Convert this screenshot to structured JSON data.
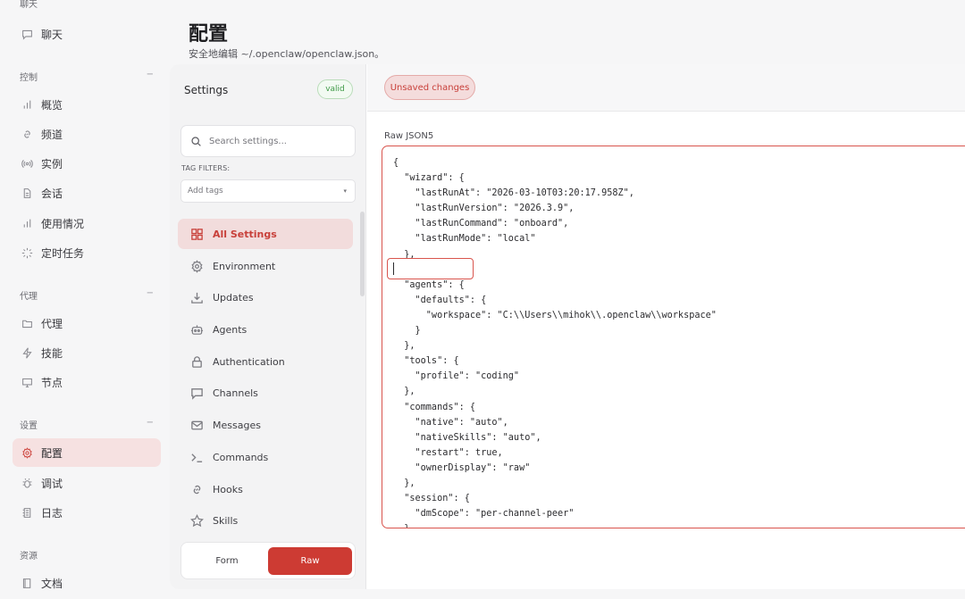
{
  "nav": {
    "top_cut_label": "聊天",
    "sections": [
      {
        "key": "control",
        "label": "控制",
        "collapse": "−"
      },
      {
        "key": "agent",
        "label": "代理",
        "collapse": "−"
      },
      {
        "key": "settings",
        "label": "设置",
        "collapse": "−"
      },
      {
        "key": "resources",
        "label": "资源",
        "collapse": ""
      }
    ],
    "items": [
      {
        "label": "聊天",
        "icon": "chat-icon"
      },
      {
        "label": "概览",
        "icon": "bar-chart-icon"
      },
      {
        "label": "频道",
        "icon": "link-icon"
      },
      {
        "label": "实例",
        "icon": "broadcast-icon"
      },
      {
        "label": "会话",
        "icon": "document-icon"
      },
      {
        "label": "使用情况",
        "icon": "bar-chart-icon"
      },
      {
        "label": "定时任务",
        "icon": "loader-icon"
      },
      {
        "label": "代理",
        "icon": "folder-icon"
      },
      {
        "label": "技能",
        "icon": "lightning-icon"
      },
      {
        "label": "节点",
        "icon": "monitor-icon"
      },
      {
        "label": "配置",
        "icon": "gear-icon",
        "active": true
      },
      {
        "label": "调试",
        "icon": "bug-icon"
      },
      {
        "label": "日志",
        "icon": "log-icon"
      },
      {
        "label": "文档",
        "icon": "book-icon"
      }
    ]
  },
  "header": {
    "title": "配置",
    "subtitle": "安全地编辑 ~/.openclaw/openclaw.json。"
  },
  "settings": {
    "title": "Settings",
    "status_badge": "valid",
    "search_placeholder": "Search settings...",
    "tag_filters_label": "TAG FILTERS:",
    "tag_placeholder": "Add tags",
    "categories": [
      {
        "label": "All Settings",
        "icon": "grid-icon",
        "active": true
      },
      {
        "label": "Environment",
        "icon": "gear-icon"
      },
      {
        "label": "Updates",
        "icon": "download-icon"
      },
      {
        "label": "Agents",
        "icon": "robot-icon"
      },
      {
        "label": "Authentication",
        "icon": "lock-icon"
      },
      {
        "label": "Channels",
        "icon": "chat-icon"
      },
      {
        "label": "Messages",
        "icon": "mail-icon"
      },
      {
        "label": "Commands",
        "icon": "terminal-icon"
      },
      {
        "label": "Hooks",
        "icon": "link-icon"
      },
      {
        "label": "Skills",
        "icon": "star-icon"
      }
    ],
    "mode_form": "Form",
    "mode_raw": "Raw"
  },
  "editor": {
    "unsaved_label": "Unsaved changes",
    "raw_label": "Raw JSON5",
    "lines": [
      "{",
      "  \"wizard\": {",
      "    \"lastRunAt\": \"2026-03-10T03:20:17.958Z\",",
      "    \"lastRunVersion\": \"2026.3.9\",",
      "    \"lastRunCommand\": \"onboard\",",
      "    \"lastRunMode\": \"local\"",
      "  },",
      "",
      "  \"agents\": {",
      "    \"defaults\": {",
      "      \"workspace\": \"C:\\\\Users\\\\mihok\\\\.openclaw\\\\workspace\"",
      "    }",
      "  },",
      "  \"tools\": {",
      "    \"profile\": \"coding\"",
      "  },",
      "  \"commands\": {",
      "    \"native\": \"auto\",",
      "    \"nativeSkills\": \"auto\",",
      "    \"restart\": true,",
      "    \"ownerDisplay\": \"raw\"",
      "  },",
      "  \"session\": {",
      "    \"dmScope\": \"per-channel-peer\"",
      "  },"
    ]
  },
  "colors": {
    "accent": "#cd3b33",
    "accent_soft": "#f2dcdc",
    "valid": "#3f9a47"
  }
}
